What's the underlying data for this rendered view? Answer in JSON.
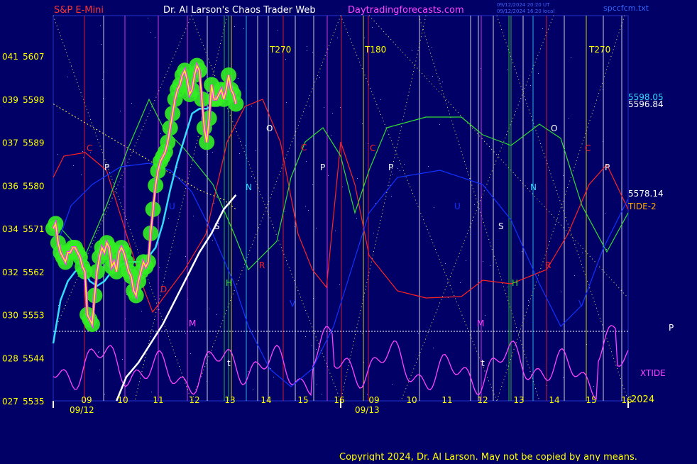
{
  "header": {
    "left_title": "S&P E-Mini",
    "center_title": "Dr. Al Larson's Chaos Trader Web",
    "site": "Daytradingforecasts.com",
    "timestamp_line1": "09/12/2024 20:20 UT",
    "timestamp_line2": "09/12/2024 16:20 local",
    "filename": "spccfcm.txt"
  },
  "footer": {
    "copyright": "Copyright 2024, Dr. Al Larson. May not be copied by any means.",
    "year": "2024"
  },
  "colors": {
    "background": "#000066",
    "price": "#ffff00",
    "price_core": "#ff33ff",
    "glow": "#33ee22",
    "ema_fast": "#33ddff",
    "ema_slow": "#ffffff",
    "tide": "#ffaa00",
    "xtide": "#ff44ff",
    "red_curve": "#ff2222",
    "green_curve": "#33dd33",
    "blue_curve": "#1133ff",
    "label_red": "#ff2222",
    "label_white": "#ffffff"
  },
  "chart_data": {
    "type": "line",
    "title": "S&P E-Mini",
    "x_tick_labels": [
      "09",
      "10",
      "11",
      "12",
      "13",
      "14",
      "15",
      "16",
      "09",
      "10",
      "11",
      "12",
      "13",
      "14",
      "15",
      "16"
    ],
    "date_labels": [
      "09/12",
      "09/13"
    ],
    "y_axis_labels": [
      {
        "left": "041",
        "price": "5607",
        "value": 5607
      },
      {
        "left": "039",
        "price": "5598",
        "value": 5598
      },
      {
        "left": "037",
        "price": "5589",
        "value": 5589
      },
      {
        "left": "036",
        "price": "5580",
        "value": 5580
      },
      {
        "left": "034",
        "price": "5571",
        "value": 5571
      },
      {
        "left": "032",
        "price": "5562",
        "value": 5562
      },
      {
        "left": "030",
        "price": "5553",
        "value": 5553
      },
      {
        "left": "028",
        "price": "5544",
        "value": 5544
      },
      {
        "left": "027",
        "price": "5535",
        "value": 5535
      }
    ],
    "ylim": [
      5535,
      5607
    ],
    "x_range_hours": [
      8.5,
      32.1
    ],
    "right_labels": [
      {
        "text": "5598.05",
        "value": 5598.05,
        "color": "#33ddff"
      },
      {
        "text": "5596.84",
        "value": 5596.84,
        "color": "#ffffff"
      },
      {
        "text": "5578.14",
        "value": 5578.14,
        "color": "#ffffff"
      },
      {
        "text": "TIDE-2",
        "value": 5571.8,
        "color": "#ffaa00"
      },
      {
        "text": "XTIDE",
        "value": 5543.6,
        "color": "#ff44ff"
      }
    ],
    "timing_labels": [
      "T270",
      "T180",
      "T270"
    ],
    "chart_point_labels": [
      "C",
      "P",
      "O",
      "N",
      "U",
      "S",
      "M",
      "H",
      "V",
      "R",
      "t",
      "D",
      "C",
      "P",
      "C",
      "P",
      "O",
      "N",
      "U",
      "S",
      "M",
      "H",
      "R",
      "t",
      "C",
      "P",
      "V"
    ],
    "series": [
      {
        "name": "price",
        "x": [
          8.5,
          8.6,
          8.7,
          8.8,
          8.9,
          9.0,
          9.1,
          9.2,
          9.3,
          9.4,
          9.5,
          9.6,
          9.7,
          9.8,
          9.9,
          10.0,
          10.1,
          10.2,
          10.3,
          10.4,
          10.5,
          10.6,
          10.7,
          10.8,
          10.9,
          11.0,
          11.1,
          11.2,
          11.3,
          11.4,
          11.5,
          11.6,
          11.7,
          11.8,
          11.9,
          12.0,
          12.1,
          12.2,
          12.3,
          12.4,
          12.5,
          12.6,
          12.7,
          12.8,
          12.9,
          13.0,
          13.1,
          13.2,
          13.3,
          13.4,
          13.5,
          13.6,
          13.7,
          13.8,
          13.9,
          14.0,
          14.1,
          14.2,
          14.3,
          14.4,
          14.5,
          14.6,
          14.7,
          14.8,
          14.9,
          15.0,
          15.1,
          15.2,
          15.3,
          15.4,
          15.5,
          15.6,
          15.7,
          15.8,
          15.9,
          16.0
        ],
        "values": [
          5571,
          5572,
          5568,
          5566,
          5565,
          5564,
          5566,
          5566,
          5567,
          5567,
          5566,
          5565,
          5563,
          5562,
          5553,
          5552,
          5551,
          5557,
          5562,
          5565,
          5567,
          5566,
          5568,
          5567,
          5563,
          5564,
          5562,
          5566,
          5567,
          5566,
          5564,
          5562,
          5561,
          5558,
          5557,
          5560,
          5562,
          5564,
          5563,
          5564,
          5570,
          5575,
          5580,
          5583,
          5585,
          5586,
          5587,
          5589,
          5592,
          5595,
          5598,
          5600,
          5601,
          5603,
          5604,
          5602,
          5599,
          5600,
          5603,
          5605,
          5604,
          5598,
          5592,
          5589,
          5594,
          5601,
          5598,
          5598,
          5599,
          5600,
          5598,
          5600,
          5603,
          5600,
          5599,
          5597
        ]
      },
      {
        "name": "ema_fast",
        "x": [
          8.5,
          8.8,
          9.1,
          9.4,
          9.7,
          10.0,
          10.3,
          10.6,
          10.9,
          11.2,
          11.5,
          11.8,
          12.1,
          12.4,
          12.7,
          13.0,
          13.3,
          13.6,
          13.9,
          14.2,
          14.5,
          14.8,
          15.1,
          15.4,
          15.7,
          16.0
        ],
        "values": [
          5547,
          5556,
          5560,
          5562,
          5563,
          5560,
          5559,
          5560,
          5562,
          5563,
          5564,
          5564,
          5564,
          5565,
          5567,
          5572,
          5579,
          5585,
          5590,
          5595,
          5596,
          5596,
          5597,
          5598,
          5598,
          5598
        ]
      },
      {
        "name": "ema_slow",
        "x": [
          11.1,
          11.5,
          12.0,
          12.5,
          13.0,
          13.5,
          14.0,
          14.5,
          15.0,
          15.5,
          16.0
        ],
        "values": [
          5535,
          5540,
          5543,
          5547,
          5551,
          5556,
          5561,
          5566,
          5570,
          5575,
          5578
        ]
      },
      {
        "name": "TIDE-2",
        "x": [
          8.5,
          9.5,
          10.5,
          11.5,
          12.5,
          13.5,
          14.5,
          15.5,
          16.0
        ],
        "values": [
          5597,
          5594,
          5591,
          5588,
          5585,
          5582,
          5579,
          5577,
          5575
        ]
      }
    ]
  }
}
